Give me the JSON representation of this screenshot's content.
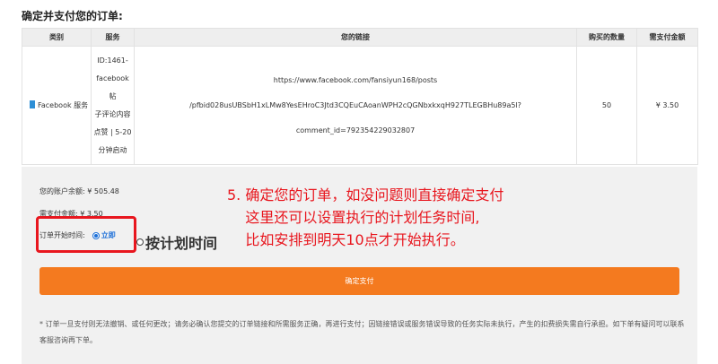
{
  "page": {
    "title": "确定并支付您的订单:"
  },
  "table": {
    "headers": [
      "类别",
      "服务",
      "您的链接",
      "购买的数量",
      "需支付金额"
    ],
    "row": {
      "category": "Facebook 服务",
      "service_lines": [
        "ID:1461-",
        "facebook帖",
        "子评论内容",
        "点赞 | 5-20",
        "分钟启动"
      ],
      "link_line1": "https://www.facebook.com/fansiyun168/posts",
      "link_line2": "/pfbid028usUBSbH1xLMw8YesEHroC3Jtd3CQEuCAoanWPH2cQGNbxkxqH927TLEGBHu89a5l?comment_id=792354229032807",
      "quantity": "50",
      "price": "¥ 3.50"
    }
  },
  "summary": {
    "balance_label": "您的账户余额:",
    "balance_value": "¥ 505.48",
    "due_label": "需支付金额:",
    "due_value": "¥ 3.50",
    "start_label": "订单开始时间:",
    "option_now": "立即",
    "option_plan": "按计划时间"
  },
  "annotation": {
    "line1": "5. 确定您的订单，如没问题则直接确定支付",
    "line2": "    这里还可以设置执行的计划任务时间,",
    "line3": "    比如安排到明天10点才开始执行。"
  },
  "button": {
    "confirm_label": "确定支付"
  },
  "disclaimer": "* 订单一旦支付则无法撤销、或任何更改；请务必确认您提交的订单链接和所需服务正确，再进行支付；因链接错误或服务错误导致的任务实际未执行，产生的扣费损失需自行承担。如下单有疑问可以联系客服咨询再下单。",
  "colors": {
    "accent": "#f47a1f",
    "annotation": "#e8161e",
    "radio": "#1c6fd8",
    "price": "#e02020"
  }
}
